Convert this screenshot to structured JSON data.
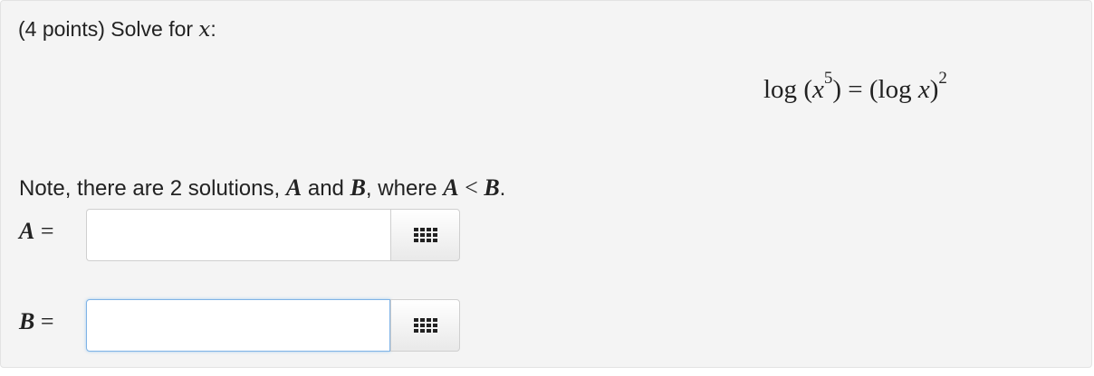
{
  "prompt": {
    "prefix": "(4 points) Solve for ",
    "var": "x",
    "suffix": ":"
  },
  "equation": {
    "lhs_log": "log",
    "lhs_open": " (",
    "lhs_x": "x",
    "lhs_exp": "5",
    "lhs_close": ")",
    "eq": " = ",
    "rhs_open": "(log ",
    "rhs_x": "x",
    "rhs_close": ")",
    "rhs_exp": "2"
  },
  "note": {
    "t1": "Note, there are 2 solutions, ",
    "A": "A",
    "t2": " and ",
    "B": "B",
    "t3": ", where ",
    "A2": "A",
    "lt": " < ",
    "B2": "B",
    "t4": "."
  },
  "answers": [
    {
      "label": "A",
      "eq": " =",
      "value": "",
      "focused": false
    },
    {
      "label": "B",
      "eq": " =",
      "value": "",
      "focused": true
    }
  ],
  "icons": {
    "keypad": "keypad-grid-icon"
  }
}
